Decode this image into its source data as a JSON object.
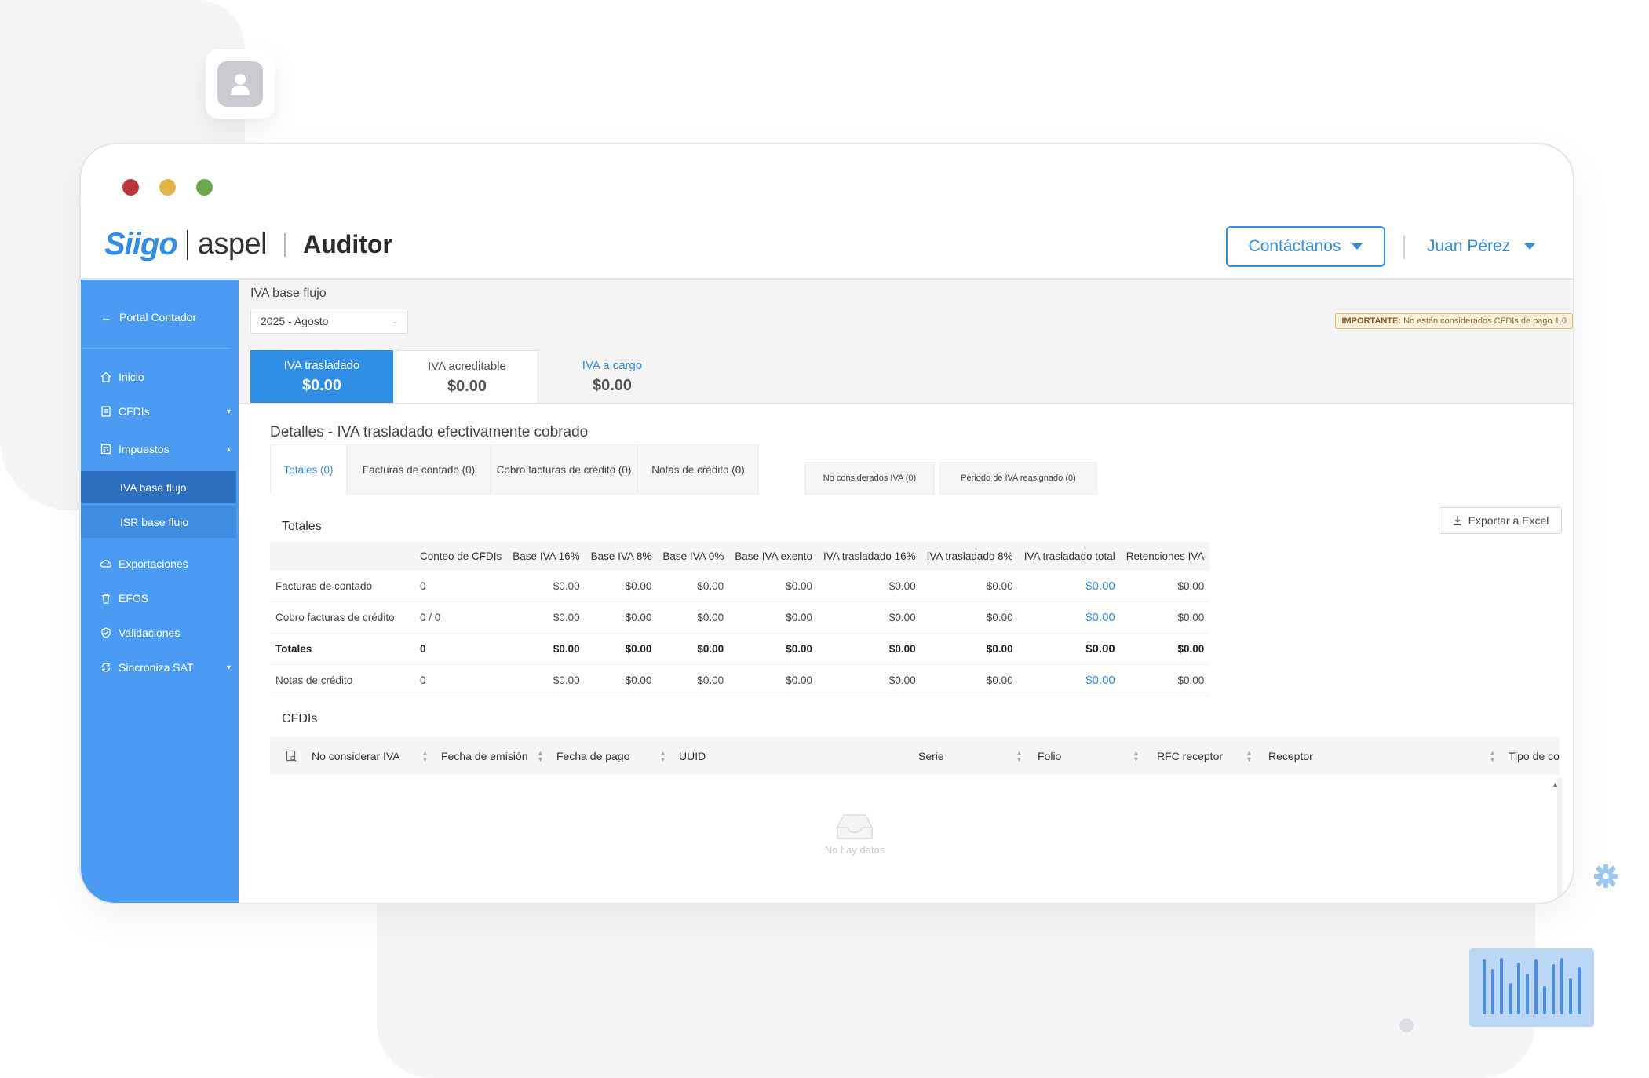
{
  "colors": {
    "accent": "#2f8de4",
    "sidebar": "#4b9bf2",
    "sidebar_active": "#2d6fbf"
  },
  "brand": {
    "siigo": "Siigo",
    "aspel": "aspel",
    "product": "Auditor"
  },
  "header": {
    "contact_label": "Contáctanos",
    "user_name": "Juan Pérez"
  },
  "sidebar": {
    "back_label": "Portal Contador",
    "items": [
      {
        "label": "Inicio",
        "icon": "home-icon"
      },
      {
        "label": "CFDIs",
        "icon": "document-icon"
      },
      {
        "label": "Impuestos",
        "icon": "calculator-icon"
      },
      {
        "label": "IVA base flujo"
      },
      {
        "label": "ISR base flujo"
      },
      {
        "label": "Exportaciones",
        "icon": "cloud-icon"
      },
      {
        "label": "EFOS",
        "icon": "trash-icon"
      },
      {
        "label": "Validaciones",
        "icon": "shield-check-icon"
      },
      {
        "label": "Sincroniza SAT",
        "icon": "sync-icon"
      }
    ]
  },
  "main": {
    "section_title": "IVA base flujo",
    "period": "2025 - Agosto",
    "important_prefix": "IMPORTANTE:",
    "important_text": "No están considerados CFDIs de pago 1.0",
    "summary_tabs": [
      {
        "label": "IVA trasladado",
        "value": "$0.00"
      },
      {
        "label": "IVA acreditable",
        "value": "$0.00"
      },
      {
        "label": "IVA a cargo",
        "value": "$0.00"
      }
    ],
    "details_title": "Detalles - IVA trasladado efectivamente cobrado",
    "detail_tabs": [
      "Totales (0)",
      "Facturas de contado (0)",
      "Cobro facturas de crédito (0)",
      "Notas de crédito (0)",
      "No considerados IVA (0)",
      "Periodo de IVA reasignado (0)"
    ],
    "totales_label": "Totales",
    "export_label": "Exportar a Excel",
    "totals_table": {
      "headers": [
        "",
        "Conteo de CFDIs",
        "Base IVA 16%",
        "Base IVA 8%",
        "Base IVA 0%",
        "Base IVA exento",
        "IVA trasladado 16%",
        "IVA trasladado 8%",
        "IVA trasladado total",
        "Retenciones IVA"
      ],
      "rows": [
        [
          "Facturas de contado",
          "0",
          "$0.00",
          "$0.00",
          "$0.00",
          "$0.00",
          "$0.00",
          "$0.00",
          "$0.00",
          "$0.00"
        ],
        [
          "Cobro facturas de crédito",
          "0 / 0",
          "$0.00",
          "$0.00",
          "$0.00",
          "$0.00",
          "$0.00",
          "$0.00",
          "$0.00",
          "$0.00"
        ],
        [
          "Totales",
          "0",
          "$0.00",
          "$0.00",
          "$0.00",
          "$0.00",
          "$0.00",
          "$0.00",
          "$0.00",
          "$0.00"
        ],
        [
          "Notas de crédito",
          "0",
          "$0.00",
          "$0.00",
          "$0.00",
          "$0.00",
          "$0.00",
          "$0.00",
          "$0.00",
          "$0.00"
        ]
      ]
    },
    "cfdis_label": "CFDIs",
    "cfdi_columns": [
      "No considerar IVA",
      "Fecha de emisión",
      "Fecha de pago",
      "UUID",
      "Serie",
      "Folio",
      "RFC receptor",
      "Receptor",
      "Tipo de com"
    ],
    "empty_text": "No hay datos"
  }
}
